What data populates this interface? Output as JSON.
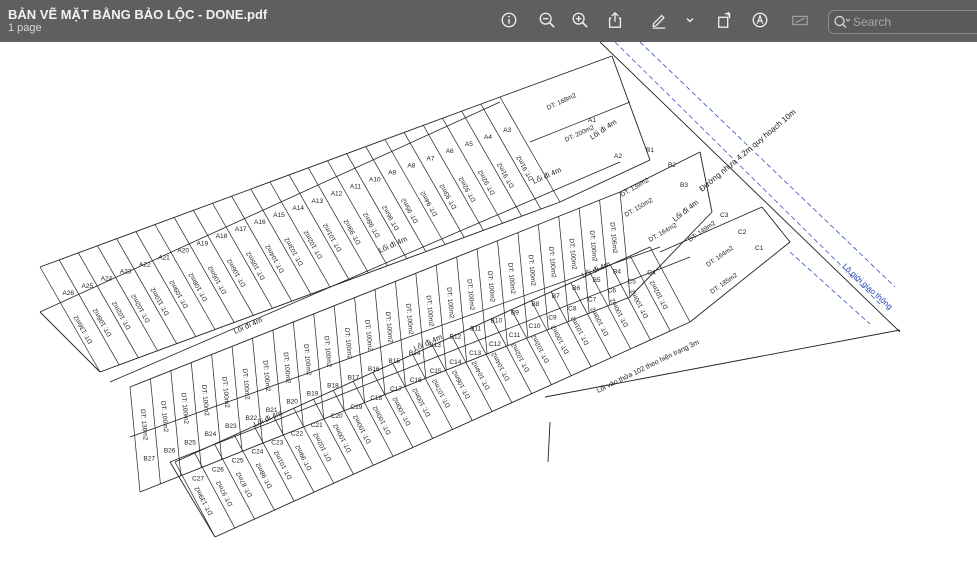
{
  "window": {
    "title": "BẢN VẼ MẶT BẰNG BẢO LỘC - DONE.pdf",
    "subtitle": "1 page"
  },
  "toolbar": {
    "icons": [
      "info-icon",
      "zoom-out-icon",
      "zoom-in-icon",
      "share-icon",
      "markup-pen-icon",
      "chevron-down-icon",
      "rotate-icon",
      "annotate-icon",
      "redact-icon"
    ],
    "search_placeholder": "Search"
  },
  "plan": {
    "labels": {
      "main_road": "Đường nhựa 4.2m quy hoạch 10m",
      "boundary": "Lộ giới giao thông",
      "access_road": "Lối vào thửa 102 theo hiện trạng 3m",
      "alley_a": "Lối đi 4m",
      "alley_a2": "Lối đi 4m",
      "alley_b": "Lối đi 4m",
      "alley_b2": "Lối đi 4m",
      "alley_c": "Lối đi 4m",
      "alley_c2": "Lối đi 4m",
      "alley_d": "Lối đi 4m"
    },
    "row_a": [
      {
        "id": "A1",
        "area": "DT: 168m2"
      },
      {
        "id": "A2",
        "area": "DT: 200m2"
      },
      {
        "id": "A3",
        "area": "DT: 91m2"
      },
      {
        "id": "A4",
        "area": "DT: 91m2"
      },
      {
        "id": "A5",
        "area": "DT: 92m2"
      },
      {
        "id": "A6",
        "area": "DT: 92m2"
      },
      {
        "id": "A7",
        "area": "DT: 93m2"
      },
      {
        "id": "A8",
        "area": "DT: 94m2"
      },
      {
        "id": "A9",
        "area": "DT: 95m2"
      },
      {
        "id": "A10",
        "area": "DT: 96m2"
      },
      {
        "id": "A11",
        "area": "DT: 98m2"
      },
      {
        "id": "A12",
        "area": "DT: 99m2"
      },
      {
        "id": "A13",
        "area": "DT: 101m2"
      },
      {
        "id": "A14",
        "area": "DT: 102m2"
      },
      {
        "id": "A15",
        "area": "DT: 103m2"
      },
      {
        "id": "A16",
        "area": "DT: 104m2"
      },
      {
        "id": "A17",
        "area": "DT: 105m2"
      },
      {
        "id": "A18",
        "area": "DT: 106m2"
      },
      {
        "id": "A19",
        "area": "DT: 106m2"
      },
      {
        "id": "A20",
        "area": "DT: 108m2"
      },
      {
        "id": "A21",
        "area": "DT: 109m2"
      },
      {
        "id": "A22",
        "area": "DT: 110m2"
      },
      {
        "id": "A23",
        "area": "DT: 102m2"
      },
      {
        "id": "A24",
        "area": "DT: 102m2"
      },
      {
        "id": "A25",
        "area": "DT: 108m2"
      },
      {
        "id": "A26",
        "area": "DT: 136m2"
      }
    ],
    "row_b": [
      {
        "id": "B1",
        "area": "DT: 139m2"
      },
      {
        "id": "B2",
        "area": "DT: 150m2"
      },
      {
        "id": "B3",
        "area": "DT: 164m2"
      },
      {
        "id": "B4",
        "area": "DT: 106m2"
      },
      {
        "id": "B5",
        "area": "DT: 100m2"
      },
      {
        "id": "B6",
        "area": "DT: 100m2"
      },
      {
        "id": "B7",
        "area": "DT: 100m2"
      },
      {
        "id": "B8",
        "area": "DT: 100m2"
      },
      {
        "id": "B9",
        "area": "DT: 100m2"
      },
      {
        "id": "B10",
        "area": "DT: 100m2"
      },
      {
        "id": "B11",
        "area": "DT: 100m2"
      },
      {
        "id": "B12",
        "area": "DT: 100m2"
      },
      {
        "id": "B13",
        "area": "DT: 100m2"
      },
      {
        "id": "B14",
        "area": "DT: 100m2"
      },
      {
        "id": "B15",
        "area": "DT: 100m2"
      },
      {
        "id": "B16",
        "area": "DT: 100m2"
      },
      {
        "id": "B17",
        "area": "DT: 100m2"
      },
      {
        "id": "B18",
        "area": "DT: 100m2"
      },
      {
        "id": "B19",
        "area": "DT: 100m2"
      },
      {
        "id": "B20",
        "area": "DT: 100m2"
      },
      {
        "id": "B21",
        "area": "DT: 100m2"
      },
      {
        "id": "B22",
        "area": "DT: 100m2"
      },
      {
        "id": "B23",
        "area": "DT: 100m2"
      },
      {
        "id": "B24",
        "area": "DT: 100m2"
      },
      {
        "id": "B25",
        "area": "DT: 100m2"
      },
      {
        "id": "B26",
        "area": "DT: 100m2"
      },
      {
        "id": "B27",
        "area": "DT: 136m2"
      }
    ],
    "row_c": [
      {
        "id": "C1",
        "area": "DT: 185m2"
      },
      {
        "id": "C2",
        "area": "DT: 164m2"
      },
      {
        "id": "C3",
        "area": "DT: 149m2"
      },
      {
        "id": "C4",
        "area": "DT: 102m2"
      },
      {
        "id": "C5",
        "area": "DT: 100m2"
      },
      {
        "id": "C6",
        "area": "DT: 100m2"
      },
      {
        "id": "C7",
        "area": "DT: 100m2"
      },
      {
        "id": "C8",
        "area": "DT: 101m2"
      },
      {
        "id": "C9",
        "area": "DT: 100m2"
      },
      {
        "id": "C10",
        "area": "DT: 102m2"
      },
      {
        "id": "C11",
        "area": "DT: 102m2"
      },
      {
        "id": "C12",
        "area": "DT: 104m2"
      },
      {
        "id": "C13",
        "area": "DT: 104m2"
      },
      {
        "id": "C14",
        "area": "DT: 106m2"
      },
      {
        "id": "C15",
        "area": "DT: 107m2"
      },
      {
        "id": "C16",
        "area": "DT: 100m2"
      },
      {
        "id": "C17",
        "area": "DT: 100m2"
      },
      {
        "id": "C18",
        "area": "DT: 100m2"
      },
      {
        "id": "C19",
        "area": "DT: 100m2"
      },
      {
        "id": "C20",
        "area": "DT: 100m2"
      },
      {
        "id": "C21",
        "area": "DT: 102m2"
      },
      {
        "id": "C22",
        "area": "DT: 99m2"
      },
      {
        "id": "C23",
        "area": "DT: 101m2"
      },
      {
        "id": "C24",
        "area": "DT: 98m2"
      },
      {
        "id": "C25",
        "area": "DT: 87m2"
      },
      {
        "id": "C26",
        "area": "DT: 97m2"
      },
      {
        "id": "C27",
        "area": "DT: 139m2"
      }
    ]
  }
}
